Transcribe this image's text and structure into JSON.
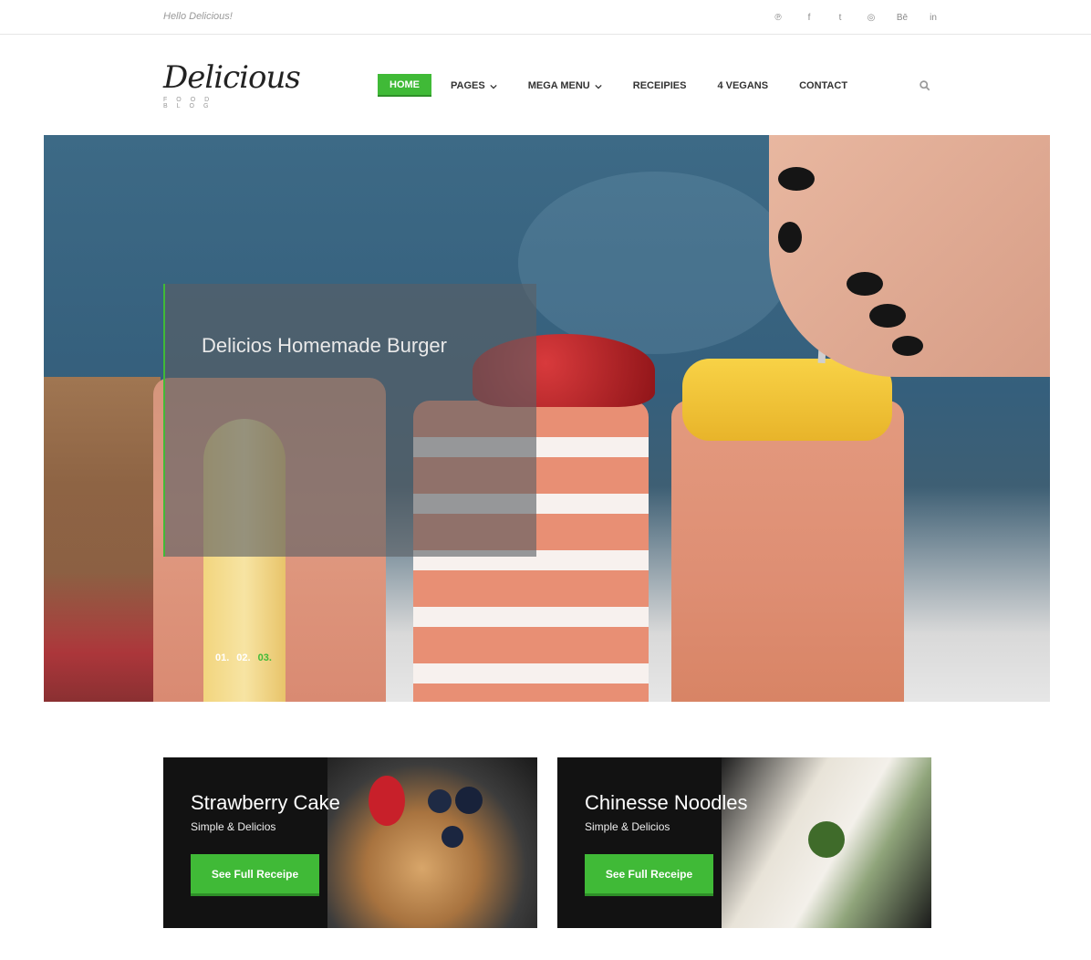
{
  "topbar": {
    "greeting": "Hello Delicious!",
    "socials": [
      {
        "icon": "pinterest-icon",
        "glyph": "℗"
      },
      {
        "icon": "facebook-icon",
        "glyph": "f"
      },
      {
        "icon": "twitter-icon",
        "glyph": "t"
      },
      {
        "icon": "dribbble-icon",
        "glyph": "◎"
      },
      {
        "icon": "behance-icon",
        "glyph": "Bē"
      },
      {
        "icon": "linkedin-icon",
        "glyph": "in"
      }
    ]
  },
  "logo": {
    "name": "Delicious",
    "tagline": "FOOD BLOG"
  },
  "nav": {
    "items": [
      {
        "label": "HOME"
      },
      {
        "label": "PAGES"
      },
      {
        "label": "MEGA MENU"
      },
      {
        "label": "RECEIPIES"
      },
      {
        "label": "4 VEGANS"
      },
      {
        "label": "CONTACT"
      }
    ]
  },
  "hero": {
    "title": "Delicios Homemade Burger",
    "slides": [
      "01.",
      "02.",
      "03."
    ],
    "active_slide": "03."
  },
  "cards": [
    {
      "title": "Strawberry Cake",
      "subtitle": "Simple & Delicios",
      "button": "See Full Receipe"
    },
    {
      "title": "Chinesse Noodles",
      "subtitle": "Simple & Delicios",
      "button": "See Full Receipe"
    }
  ],
  "colors": {
    "accent": "#40ba37",
    "accent_dark": "#2e8f28"
  }
}
